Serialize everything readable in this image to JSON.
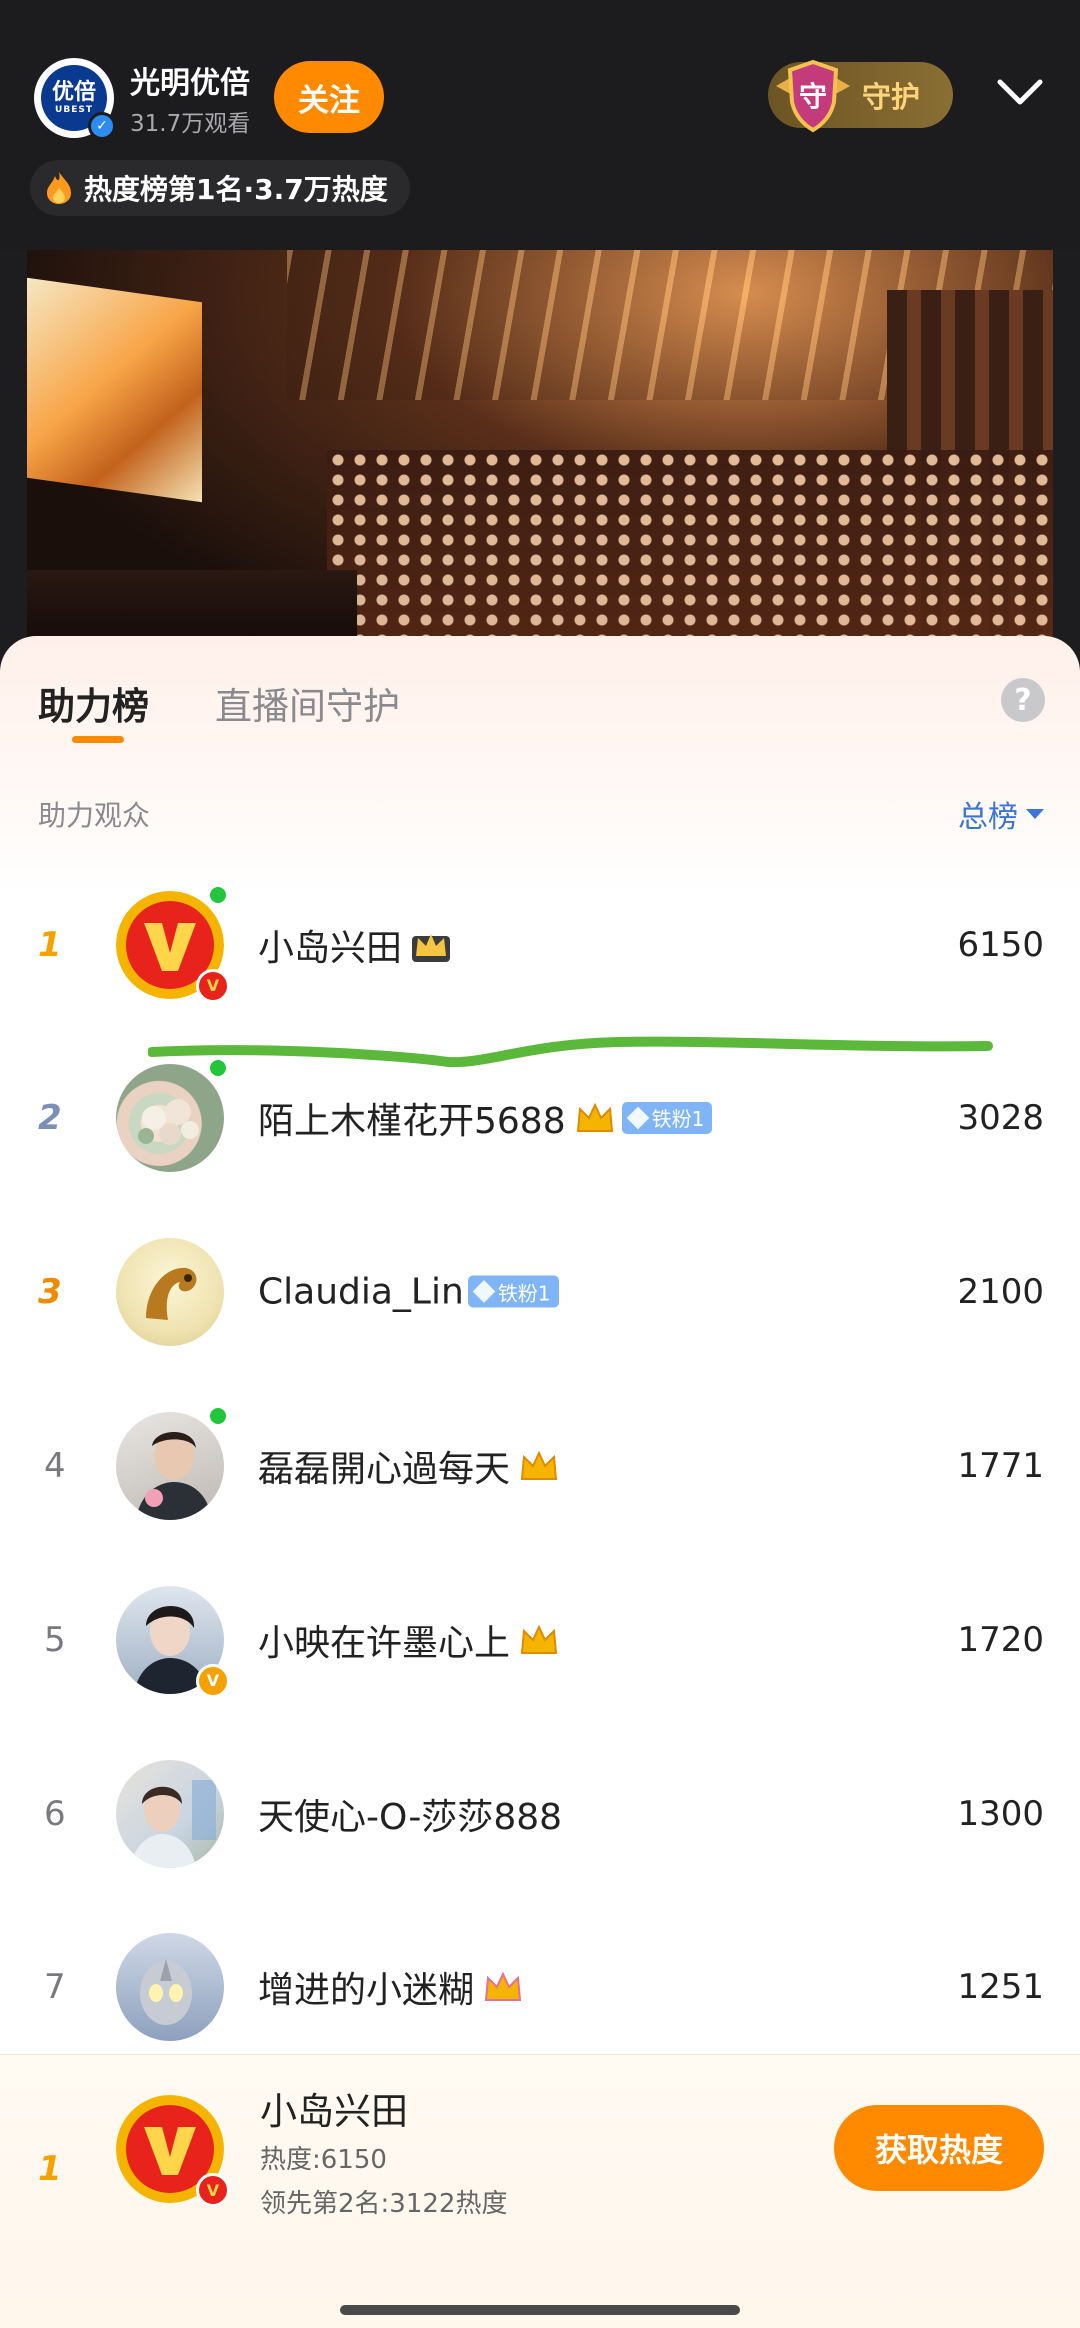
{
  "header": {
    "host_name": "光明优倍",
    "brand_text": "优倍",
    "brand_sub": "UBEST",
    "viewers": "31.7万观看",
    "follow_label": "关注",
    "guard_label": "守护",
    "guard_glyph": "守",
    "hot_rank": "热度榜第1名·3.7万热度"
  },
  "tabs": [
    {
      "label": "助力榜",
      "active": true
    },
    {
      "label": "直播间守护",
      "active": false
    }
  ],
  "help_label": "?",
  "section_label": "助力观众",
  "sort_label": "总榜",
  "colors": {
    "accent": "#ff8a00",
    "link": "#3b75d6",
    "online": "#23c53b",
    "annotation": "#5cb83a"
  },
  "leaderboard": [
    {
      "rank": "1",
      "name": "小岛兴田",
      "score": "6150",
      "badge": "V",
      "crown": true,
      "fan": ""
    },
    {
      "rank": "2",
      "name": "陌上木槿花开5688",
      "score": "3028",
      "badge": "",
      "crown": true,
      "fan": "铁粉1"
    },
    {
      "rank": "3",
      "name": "Claudia_Lin",
      "score": "2100",
      "badge": "",
      "crown": false,
      "fan": "铁粉1"
    },
    {
      "rank": "4",
      "name": "磊磊開心過每天",
      "score": "1771",
      "badge": "",
      "crown": true,
      "fan": ""
    },
    {
      "rank": "5",
      "name": "小映在许墨心上",
      "score": "1720",
      "badge": "V",
      "crown": true,
      "fan": ""
    },
    {
      "rank": "6",
      "name": "天使心-O-莎莎888",
      "score": "1300",
      "badge": "",
      "crown": false,
      "fan": ""
    },
    {
      "rank": "7",
      "name": "增进的小迷糊",
      "score": "1251",
      "badge": "",
      "crown": true,
      "fan": ""
    }
  ],
  "me": {
    "rank": "1",
    "name": "小岛兴田",
    "heat": "热度:6150",
    "lead": "领先第2名:3122热度",
    "button_label": "获取热度"
  }
}
